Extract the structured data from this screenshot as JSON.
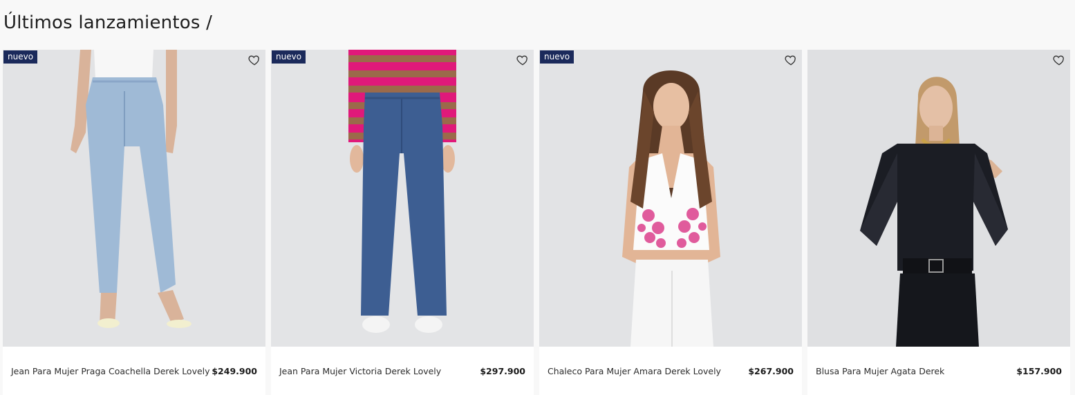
{
  "section": {
    "title": "Últimos lanzamientos /"
  },
  "products": [
    {
      "badge": "nuevo",
      "name": "Jean Para Mujer Praga Coachella Derek Lovely",
      "price": "$249.900",
      "image": "light-wash-jeans-photo"
    },
    {
      "badge": "nuevo",
      "name": "Jean Para Mujer Victoria Derek Lovely",
      "price": "$297.900",
      "image": "dark-wash-wide-jeans-photo"
    },
    {
      "badge": "nuevo",
      "name": "Chaleco Para Mujer Amara Derek Lovely",
      "price": "$267.900",
      "image": "white-embroidered-vest-photo"
    },
    {
      "badge": "",
      "name": "Blusa Para Mujer Agata Derek",
      "price": "$157.900",
      "image": "black-sheer-blouse-photo"
    }
  ],
  "icons": {
    "favorite": "heart-outline-icon"
  },
  "colors": {
    "badge": "#1b2a5b",
    "background": "#f8f8f8",
    "card": "#ffffff"
  }
}
